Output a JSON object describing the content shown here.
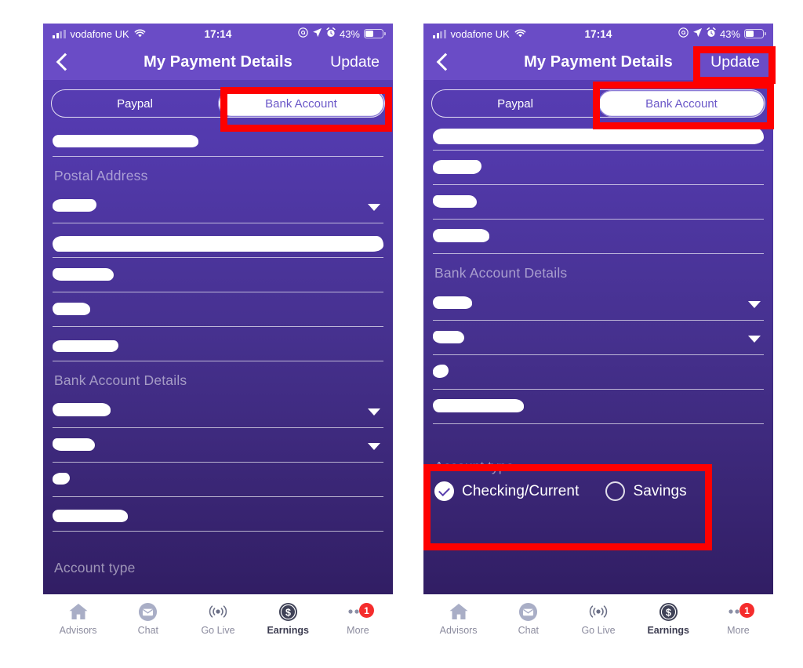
{
  "status_bar": {
    "carrier": "vodafone UK",
    "time": "17:14",
    "battery_percent": "43%",
    "icons": [
      "signal-bars-icon",
      "wifi-icon",
      "do-not-disturb-icon",
      "location-arrow-icon",
      "alarm-clock-icon",
      "battery-icon"
    ]
  },
  "nav": {
    "back": "‹",
    "title": "My Payment Details",
    "action": "Update"
  },
  "tabs": {
    "paypal": "Paypal",
    "bank_account": "Bank Account",
    "selected": "Bank Account"
  },
  "sections": {
    "postal_address": "Postal Address",
    "bank_account_details": "Bank Account Details",
    "account_type": "Account type"
  },
  "account_type": {
    "label": "Account type",
    "options": [
      {
        "label": "Checking/Current",
        "selected": true
      },
      {
        "label": "Savings",
        "selected": false
      }
    ]
  },
  "tabbar": {
    "items": [
      {
        "label": "Advisors",
        "icon": "home-icon",
        "active": false,
        "badge": ""
      },
      {
        "label": "Chat",
        "icon": "envelope-icon",
        "active": false,
        "badge": ""
      },
      {
        "label": "Go Live",
        "icon": "broadcast-icon",
        "active": false,
        "badge": ""
      },
      {
        "label": "Earnings",
        "icon": "dollar-coin-icon",
        "active": true,
        "badge": ""
      },
      {
        "label": "More",
        "icon": "ellipsis-icon",
        "active": false,
        "badge": "1"
      }
    ]
  },
  "colors": {
    "bg_top": "#5b3fb8",
    "bg_bottom": "#2d1a5c",
    "header": "#6a4cc6",
    "accent_white": "#ffffff",
    "tab_active_text": "#6a57c8",
    "highlight_red": "#fe0000",
    "badge_red": "#f52c2c"
  },
  "annotations": {
    "note": "red-highlight-boxes",
    "boxes": [
      "bank-account-tab",
      "update-button",
      "account-type-panel"
    ]
  },
  "redacted_note": "form field values are obscured with white redaction marks"
}
